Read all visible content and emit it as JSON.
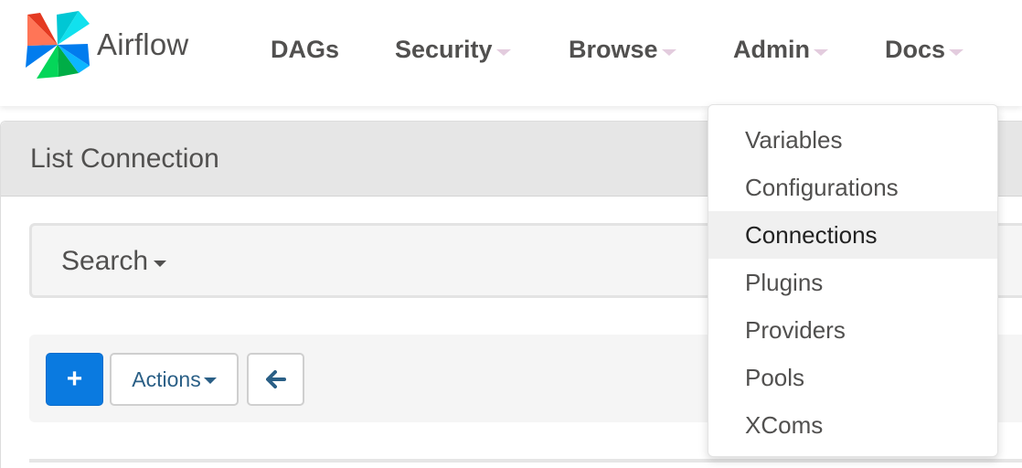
{
  "brand": {
    "name": "Airflow",
    "logo": "airflow-pinwheel-logo"
  },
  "nav": {
    "items": [
      {
        "label": "DAGs",
        "has_caret": false
      },
      {
        "label": "Security",
        "has_caret": true
      },
      {
        "label": "Browse",
        "has_caret": true
      },
      {
        "label": "Admin",
        "has_caret": true
      },
      {
        "label": "Docs",
        "has_caret": true
      }
    ]
  },
  "admin_menu": {
    "items": [
      {
        "label": "Variables"
      },
      {
        "label": "Configurations"
      },
      {
        "label": "Connections",
        "hovered": true
      },
      {
        "label": "Plugins"
      },
      {
        "label": "Providers"
      },
      {
        "label": "Pools"
      },
      {
        "label": "XComs"
      }
    ]
  },
  "panel": {
    "title": "List Connection"
  },
  "search": {
    "label": "Search"
  },
  "toolbar": {
    "add_label": "+",
    "actions_label": "Actions",
    "back_icon": "arrow-left-icon"
  },
  "colors": {
    "primary_button": "#0a7ae0",
    "nav_caret": "#e3ccde",
    "text": "#51504f",
    "heading_bg": "#e6e6e6",
    "link": "#2a5f86"
  }
}
